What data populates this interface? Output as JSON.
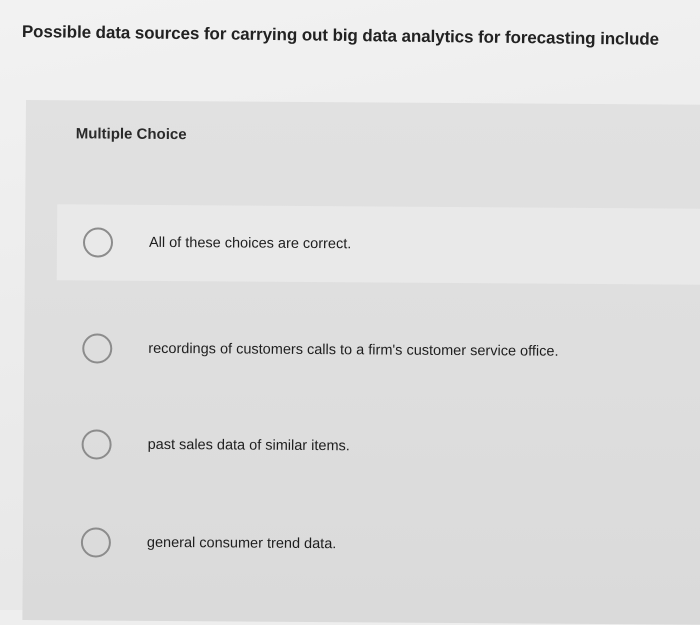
{
  "question": {
    "text": "Possible data sources for carrying out big data analytics for forecasting include"
  },
  "panel": {
    "type_label": "Multiple Choice",
    "options": [
      {
        "label": "All of these choices are correct."
      },
      {
        "label": "recordings of customers calls to a firm's customer service office."
      },
      {
        "label": "past sales data of similar items."
      },
      {
        "label": "general consumer trend data."
      }
    ]
  }
}
